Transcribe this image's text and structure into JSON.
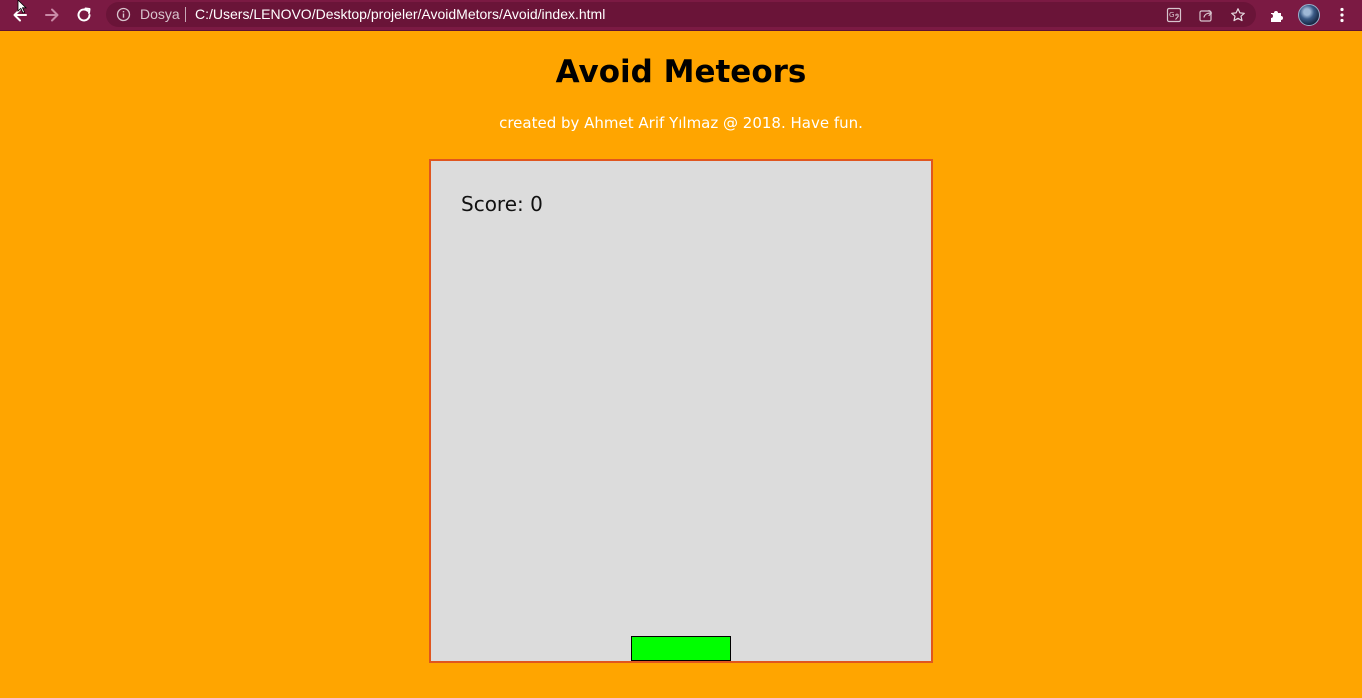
{
  "browser": {
    "origin_label": "Dosya",
    "url": "C:/Users/LENOVO/Desktop/projeler/AvoidMetors/Avoid/index.html",
    "icons": {
      "back": "arrow-left-icon",
      "forward": "arrow-right-icon",
      "reload": "reload-icon",
      "info": "info-icon",
      "translate": "translate-icon",
      "share": "share-icon",
      "bookmark": "star-icon",
      "extensions": "puzzle-icon",
      "profile": "avatar",
      "menu": "kebab-menu-icon"
    },
    "colors": {
      "toolbar": "#7b1a43",
      "omnibox": "#6a1438"
    }
  },
  "page": {
    "title": "Avoid Meteors",
    "credit": "created by Ahmet Arif Yılmaz @ 2018. Have fun.",
    "colors": {
      "background": "#ffa500",
      "credit_text": "#ffffff"
    }
  },
  "game": {
    "score_text": "Score: 0",
    "colors": {
      "field": "#dcdcdc",
      "field_border": "#e0561f",
      "player": "#00ff00"
    }
  }
}
